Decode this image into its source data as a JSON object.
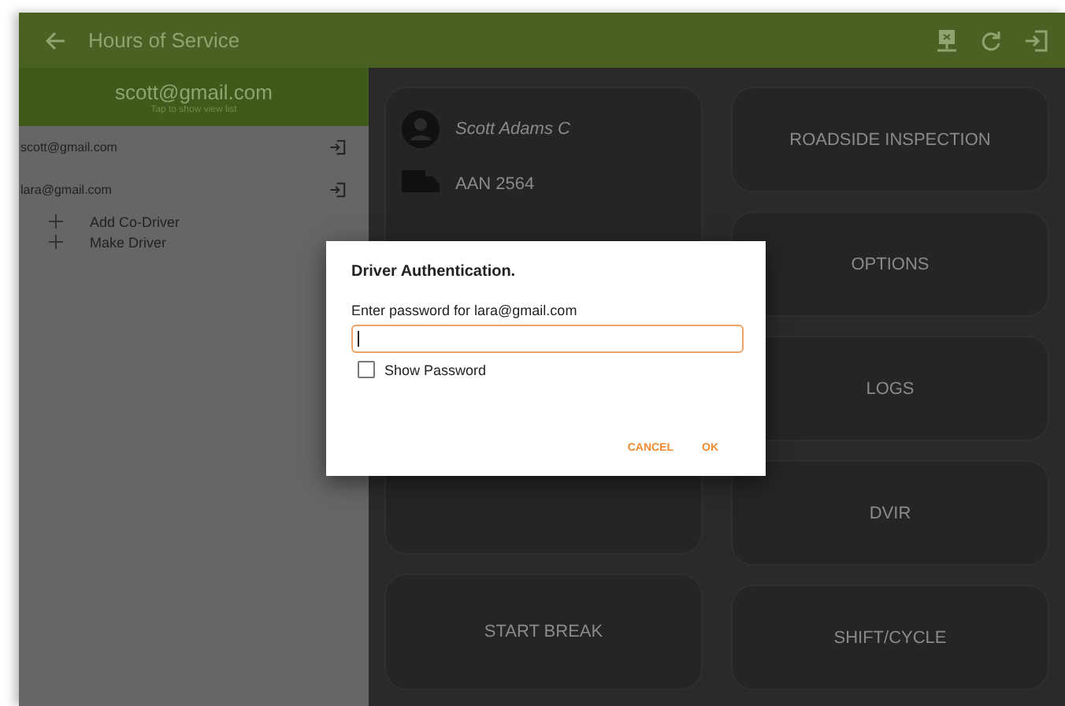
{
  "app_bar": {
    "title": "Hours of Service"
  },
  "drawer": {
    "account": "scott@gmail.com",
    "hint": "Tap to show view list",
    "drivers": [
      {
        "email": "scott@gmail.com"
      },
      {
        "email": "lara@gmail.com"
      }
    ],
    "actions": [
      {
        "label": "Add Co-Driver"
      },
      {
        "label": "Make Driver"
      }
    ]
  },
  "driver_card": {
    "name": "Scott Adams C",
    "vehicle": "AAN 2564"
  },
  "left_buttons": [
    {
      "label": "START BREAK"
    }
  ],
  "right_buttons": [
    {
      "label": "ROADSIDE INSPECTION"
    },
    {
      "label": "OPTIONS"
    },
    {
      "label": "LOGS"
    },
    {
      "label": "DVIR"
    },
    {
      "label": "SHIFT/CYCLE"
    }
  ],
  "dialog": {
    "title": "Driver Authentication.",
    "prompt": "Enter password for lara@gmail.com",
    "show_password": {
      "label": "Show Password",
      "checked": false
    },
    "buttons": [
      "CANCEL",
      "OK"
    ]
  }
}
